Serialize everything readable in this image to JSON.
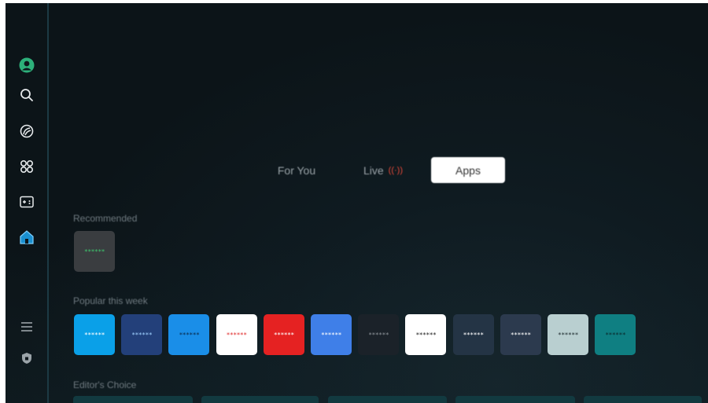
{
  "sidebar": {
    "icons": [
      "profile-icon",
      "search-icon",
      "ambient-icon",
      "apps-grid-icon",
      "gaming-icon",
      "home-icon",
      "menu-icon",
      "privacy-shield-icon"
    ],
    "active": "home-icon",
    "accent": "#1a8fcf"
  },
  "tabs": {
    "for_you": "For You",
    "live": "Live",
    "live_indicator": "((·))",
    "apps": "Apps",
    "selected": "Apps"
  },
  "sections": {
    "recommended": "Recommended",
    "popular": "Popular this week",
    "editors": "Editor's Choice"
  },
  "recommended_apps": [
    {
      "label": "******",
      "bg": "#3a3d40",
      "fg": "#3ec46d"
    }
  ],
  "popular_apps": [
    {
      "label": "******",
      "bg": "#0aa0e8",
      "fg": "#ffffff"
    },
    {
      "label": "******",
      "bg": "#23407a",
      "fg": "#9fd0ff"
    },
    {
      "label": "******",
      "bg": "#1a8ee8",
      "fg": "#0a2a4a"
    },
    {
      "label": "******",
      "bg": "#ffffff",
      "fg": "#e03030"
    },
    {
      "label": "******",
      "bg": "#e52222",
      "fg": "#ffffff"
    },
    {
      "label": "******",
      "bg": "#3f7fe8",
      "fg": "#ffffff"
    },
    {
      "label": "******",
      "bg": "#1b2229",
      "fg": "#8a9096"
    },
    {
      "label": "******",
      "bg": "#ffffff",
      "fg": "#222222"
    },
    {
      "label": "******",
      "bg": "#243445",
      "fg": "#ffffff"
    },
    {
      "label": "******",
      "bg": "#2c3a4e",
      "fg": "#ffffff"
    },
    {
      "label": "******",
      "bg": "#b9cfd0",
      "fg": "#1f2d30"
    },
    {
      "label": "******",
      "bg": "#0f7f82",
      "fg": "#0b2a2c"
    }
  ]
}
